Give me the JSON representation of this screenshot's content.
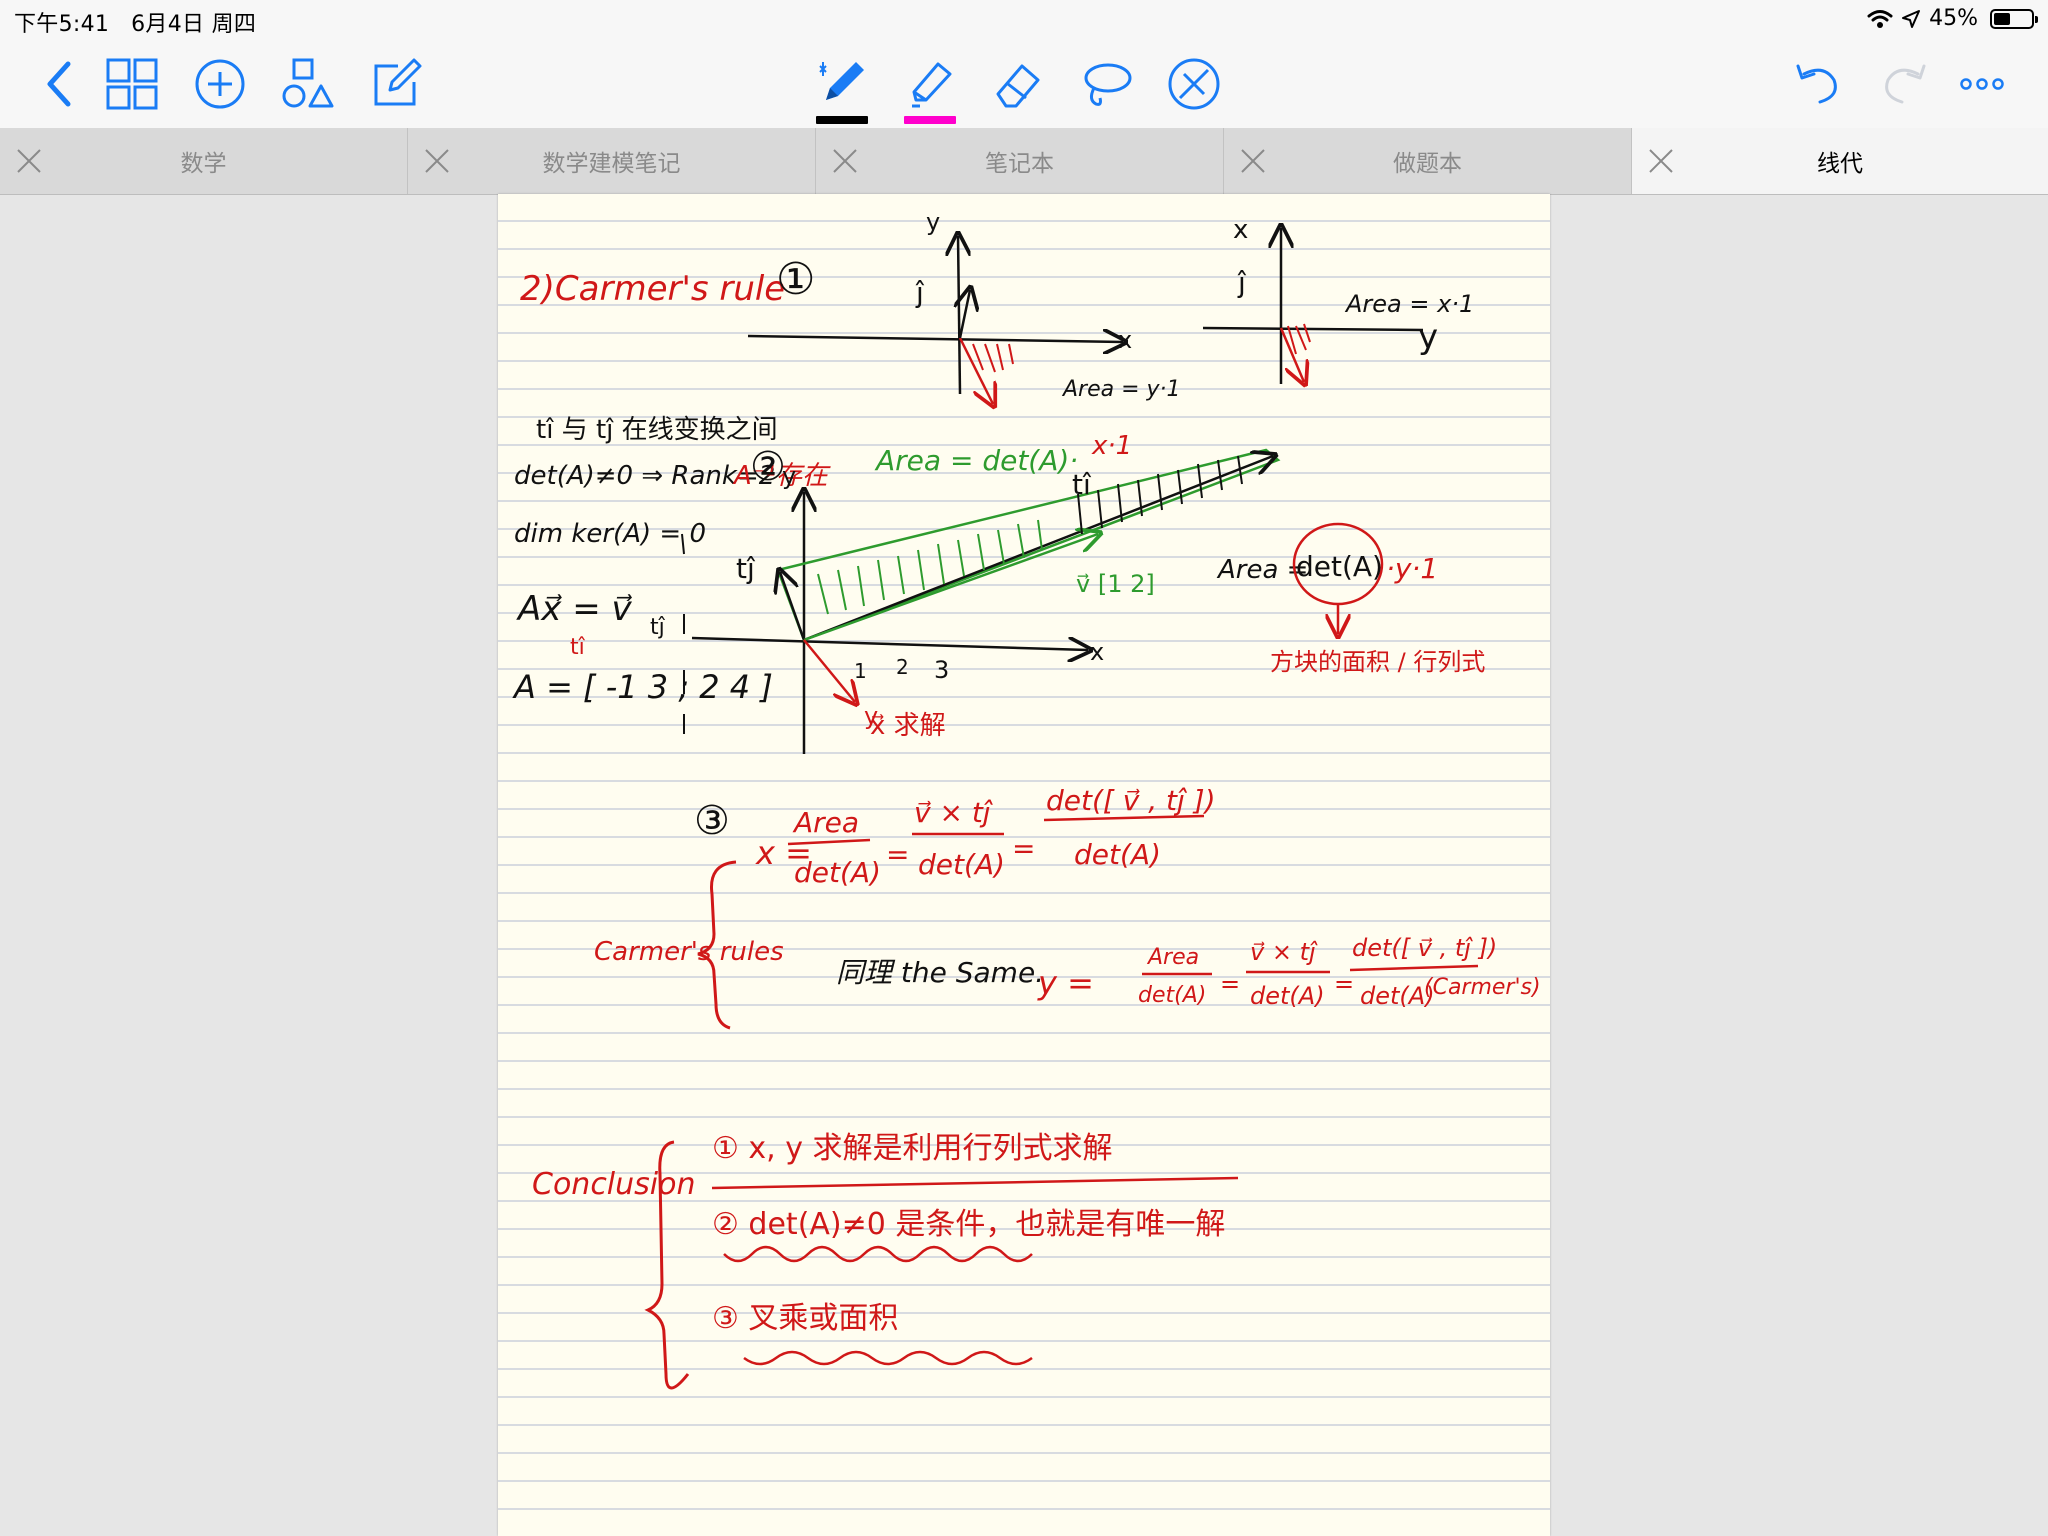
{
  "status_bar": {
    "time": "下午5:41",
    "date": "6月4日 周四",
    "battery": "45%",
    "battery_level": 0.45
  },
  "toolbar": {
    "left_icons": [
      "back-chevron-icon",
      "page-grid-icon",
      "add-circle-icon",
      "shapes-icon",
      "edit-icon"
    ],
    "center_tools": [
      "pen-icon",
      "highlighter-icon",
      "eraser-icon",
      "lasso-icon",
      "disabled-tool-icon"
    ],
    "right_icons": [
      "undo-icon",
      "redo-icon",
      "more-icon"
    ],
    "pen_color": "#000000",
    "highlighter_color": "#ff00cc",
    "accent": "#1a7cf5"
  },
  "tabs": [
    {
      "label": "数学",
      "active": false
    },
    {
      "label": "数学建模笔记",
      "active": false
    },
    {
      "label": "笔记本",
      "active": false
    },
    {
      "label": "做题本",
      "active": false
    },
    {
      "label": "线代",
      "active": true
    }
  ],
  "note": {
    "colors": {
      "black": "#111111",
      "red": "#d01818",
      "green": "#2e9b2e"
    },
    "title": "2)Carmer's rule",
    "marker1": "①",
    "marker2": "②",
    "marker3": "③",
    "graph1_area": "Area = y·1",
    "graph2_area": "Area = x·1",
    "label_i": "î",
    "label_j": "ĵ",
    "label_x": "x",
    "label_y": "y",
    "line1": "tî 与 tĵ 在线变换之间",
    "line2": "det(A)≠0 ⇒ Rank=2",
    "line2_red": "A⁻¹存在",
    "line3": "dim ker(A) = 0",
    "line4": "Ax⃗ = v⃗",
    "line5": "A = [ -1 3 ; 2 4 ]",
    "col_label_ti": "tî",
    "col_label_tj": "tĵ",
    "graph3_area_green": "Area = det(A)·",
    "graph3_area_red": "x·1",
    "graph3_area_black": "Area = ",
    "graph3_det": "det(A)",
    "graph3_area_tail": "·y·1",
    "graph3_note": "方块的面积 / 行列式",
    "graph3_vlabel": "v⃗ [1 2]",
    "graph3_ti": "tî",
    "graph3_tj": "tĵ",
    "graph3_x_solve": "x⃗ 求解",
    "tick_1": "1",
    "tick_2": "2",
    "tick_3": "3",
    "eq_x_prefix": "x =",
    "eq_x_f1_num": "Area",
    "eq_x_f1_den": "det(A)",
    "eq_x_f2_num": "v⃗ × tĵ",
    "eq_x_f2_den": "det(A)",
    "eq_x_f3_num": "det([ v⃗ , tĵ ])",
    "eq_x_f3_den": "det(A)",
    "eq_eq": "=",
    "carmer_label": "Carmer's rules",
    "same_text": "同理 the Same.",
    "eq_y_prefix": "y =",
    "eq_y_f1_num": "Area",
    "eq_y_f1_den": "det(A)",
    "eq_y_f2_num": "v⃗ × tĵ",
    "eq_y_f2_den": "det(A)",
    "eq_y_f3_num": "det([ v⃗ , tĵ ])",
    "eq_y_f3_den": "det(A)",
    "eq_y_suffix": "(Carmer's)",
    "conclusion_label": "Conclusion",
    "c1": "① x, y 求解是利用行列式求解",
    "c2": "② det(A)≠0 是条件，也就是有唯一解",
    "c3": "③ 叉乘或面积"
  }
}
